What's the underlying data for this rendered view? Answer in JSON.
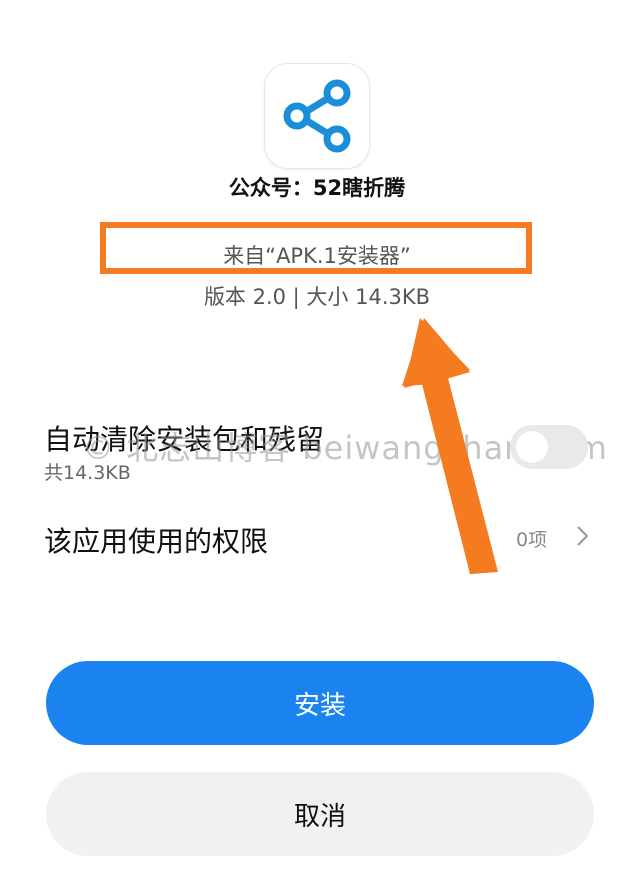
{
  "app": {
    "name": "公众号：52瞎折腾",
    "source": "来自“APK.1安装器”",
    "version_info": "版本 2.0 | 大小 14.3KB",
    "icon": "share-icon",
    "icon_color": "#1a8fd8"
  },
  "watermark": "© 北志山博客 beiwangshan.com",
  "options": {
    "auto_clean": {
      "title": "自动清除安装包和残留",
      "subtitle": "共14.3KB",
      "enabled": false
    },
    "permissions": {
      "title": "该应用使用的权限",
      "count": "0项"
    }
  },
  "buttons": {
    "install": "安装",
    "cancel": "取消"
  },
  "annotation": {
    "highlight_color": "#f47b20",
    "arrow_color": "#f47b20"
  }
}
